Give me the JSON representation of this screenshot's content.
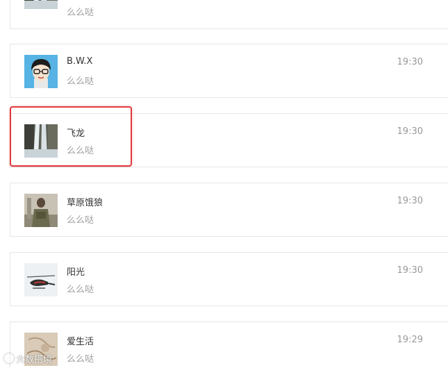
{
  "contacts": [
    {
      "name": "",
      "message": "么么哒",
      "time": "",
      "avatar": "waterfall-avatar"
    },
    {
      "name": "B.W.X",
      "message": "么么哒",
      "time": "19:30",
      "avatar": "cartoon-glasses-avatar"
    },
    {
      "name": "飞龙",
      "message": "么么哒",
      "time": "19:30",
      "avatar": "waterfall-avatar"
    },
    {
      "name": "草原饿狼",
      "message": "么么哒",
      "time": "19:30",
      "avatar": "soldier-avatar"
    },
    {
      "name": "阳光",
      "message": "么么哒",
      "time": "19:30",
      "avatar": "helicopter-avatar"
    },
    {
      "name": "爱生活",
      "message": "么么哒",
      "time": "19:29",
      "avatar": "sketch-avatar"
    }
  ],
  "highlight_color": "#e0393e",
  "watermark": {
    "text": "大数搭境"
  }
}
